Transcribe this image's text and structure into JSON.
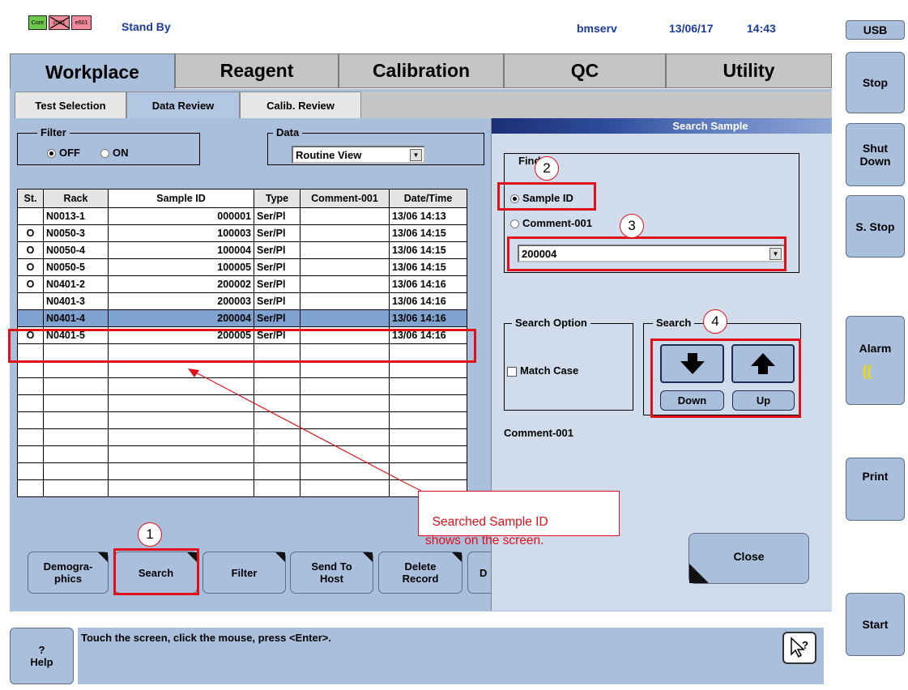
{
  "header": {
    "core_icons": [
      "Core",
      "c501",
      "e601"
    ],
    "status": "Stand By",
    "user": "bmserv",
    "date": "13/06/17",
    "time": "14:43"
  },
  "main_tabs": [
    "Workplace",
    "Reagent",
    "Calibration",
    "QC",
    "Utility"
  ],
  "sub_tabs": [
    "Test Selection",
    "Data Review",
    "Calib. Review"
  ],
  "filter": {
    "legend": "Filter",
    "off": "OFF",
    "on": "ON",
    "selected": "OFF"
  },
  "data_select": {
    "legend": "Data",
    "value": "Routine View"
  },
  "table": {
    "columns": [
      "St.",
      "Rack",
      "Sample ID",
      "Type",
      "Comment-001",
      "Date/Time"
    ],
    "rows": [
      [
        "",
        "N0013-1",
        "000001",
        "Ser/Pl",
        "",
        "13/06 14:13"
      ],
      [
        "O",
        "N0050-3",
        "100003",
        "Ser/Pl",
        "",
        "13/06 14:15"
      ],
      [
        "O",
        "N0050-4",
        "100004",
        "Ser/Pl",
        "",
        "13/06 14:15"
      ],
      [
        "O",
        "N0050-5",
        "100005",
        "Ser/Pl",
        "",
        "13/06 14:15"
      ],
      [
        "O",
        "N0401-2",
        "200002",
        "Ser/Pl",
        "",
        "13/06 14:16"
      ],
      [
        "",
        "N0401-3",
        "200003",
        "Ser/Pl",
        "",
        "13/06 14:16"
      ],
      [
        "",
        "N0401-4",
        "200004",
        "Ser/Pl",
        "",
        "13/06 14:16"
      ],
      [
        "O",
        "N0401-5",
        "200005",
        "Ser/Pl",
        "",
        "13/06 14:16"
      ]
    ],
    "selected_index": 6,
    "empty_rows": 9
  },
  "func_buttons": [
    "Demogra-\nphics",
    "Search",
    "Filter",
    "Send To\nHost",
    "Delete\nRecord",
    "D"
  ],
  "search_panel": {
    "title": "Search Sample",
    "find_legend": "Find",
    "sample_id": "Sample ID",
    "comment": "Comment-001",
    "find_value": "200004",
    "search_option_legend": "Search Option",
    "match_case": "Match Case",
    "search_legend": "Search",
    "down": "Down",
    "up": "Up",
    "comment_label": "Comment-001",
    "close": "Close"
  },
  "side_buttons": [
    "USB",
    "Stop",
    "Shut\nDown",
    "S. Stop",
    "Alarm",
    "Print",
    "Start"
  ],
  "message": "Touch the screen, click the mouse, press <Enter>.",
  "help_button": "?\nHelp",
  "annotation": {
    "callout": "Searched Sample ID\nshows on the screen.",
    "numbers": [
      "1",
      "2",
      "3",
      "4"
    ]
  },
  "colors": {
    "accent_red": "#e0101a",
    "panel_blue": "#a9bfdc",
    "highlight_row": "#7fa3d0"
  }
}
